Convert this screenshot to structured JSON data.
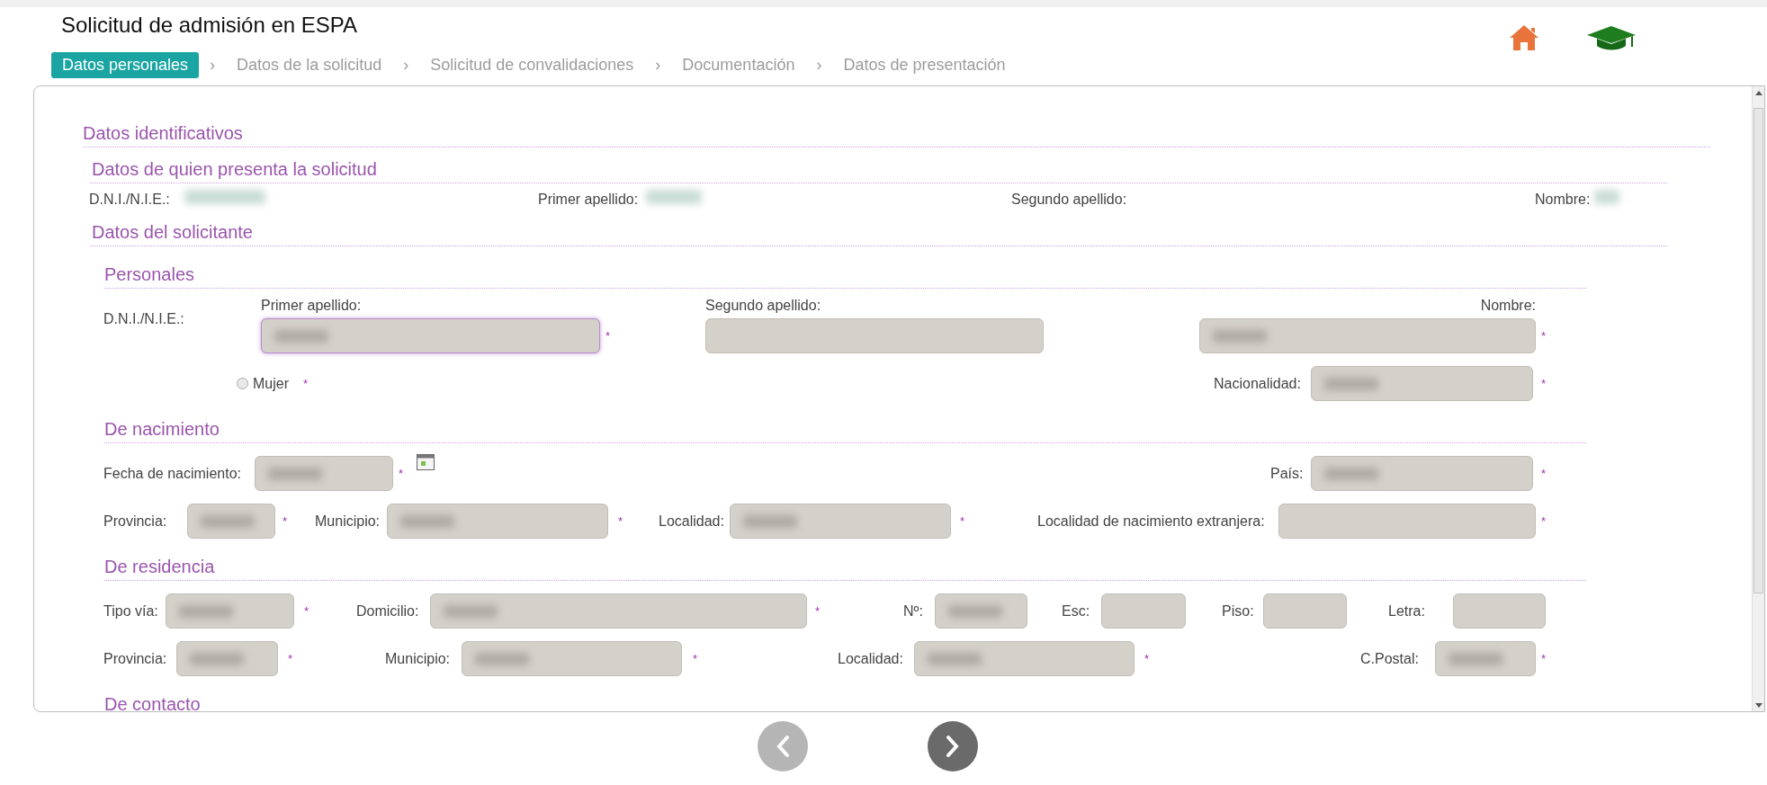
{
  "title": "Solicitud de admisión en ESPA",
  "steps": [
    {
      "label": "Datos personales",
      "selected": true
    },
    {
      "separator": "›",
      "label": "Datos de la solicitud",
      "selected": false
    },
    {
      "separator": "›",
      "label": "Solicitud de convalidaciones",
      "selected": false
    },
    {
      "separator": "›",
      "label": "Documentación",
      "selected": false
    },
    {
      "separator": "›",
      "label": "Datos de presentación",
      "selected": false
    }
  ],
  "sections": [
    {
      "title": "Datos identificativos",
      "children": [
        {
          "title": "Datos de quien presenta la solicitud",
          "rows": [
            [
              {
                "kind": "label",
                "text": "D.N.I./N.I.E.:"
              },
              {
                "kind": "value",
                "blurred": true
              },
              {
                "kind": "label",
                "text": "Primer apellido:"
              },
              {
                "kind": "value",
                "blurred": true
              },
              {
                "kind": "label",
                "text": "Segundo apellido:"
              },
              {
                "kind": "label",
                "text": "Nombre:"
              },
              {
                "kind": "value",
                "blurred": true
              }
            ]
          ]
        },
        {
          "title": "Datos del solicitante",
          "children": [
            {
              "title": "Personales",
              "rows": [
                [
                  {
                    "kind": "label",
                    "text": "D.N.I./N.I.E.:"
                  },
                  {
                    "kind": "stack",
                    "label": "Primer apellido:",
                    "blurred": true,
                    "focused": true
                  },
                  {
                    "kind": "required",
                    "text": "*"
                  },
                  {
                    "kind": "stack",
                    "label": "Segundo apellido:",
                    "blurred": false,
                    "focused": false
                  },
                  {
                    "kind": "stack",
                    "label": "Nombre:",
                    "blurred": true,
                    "focused": false
                  },
                  {
                    "kind": "required",
                    "text": "*"
                  }
                ],
                [
                  "",
                  {
                    "kind": "radio",
                    "label": "Mujer",
                    "checked": false,
                    "required": "*"
                  },
                  "",
                  {
                    "kind": "label",
                    "text": "Nacionalidad:"
                  },
                  {
                    "kind": "field",
                    "blurred": true,
                    "focused": false
                  },
                  {
                    "kind": "required",
                    "text": "*"
                  }
                ]
              ]
            },
            {
              "title": "De nacimiento",
              "rows": [
                [
                  {
                    "kind": "label",
                    "text": "Fecha de nacimiento:"
                  },
                  {
                    "kind": "field",
                    "blurred": true,
                    "focused": false
                  },
                  {
                    "kind": "required",
                    "text": "*"
                  },
                  {
                    "kind": "calendar"
                  },
                  "",
                  "",
                  "",
                  "",
                  "",
                  {
                    "kind": "label",
                    "text": "País:"
                  },
                  {
                    "kind": "field",
                    "blurred": true,
                    "focused": false
                  },
                  {
                    "kind": "required",
                    "text": "*"
                  }
                ],
                [
                  {
                    "kind": "label",
                    "text": "Provincia:"
                  },
                  {
                    "kind": "field",
                    "blurred": true,
                    "focused": false
                  },
                  {
                    "kind": "required",
                    "text": "*"
                  },
                  {
                    "kind": "label",
                    "text": "Municipio:"
                  },
                  {
                    "kind": "field",
                    "blurred": true,
                    "focused": false
                  },
                  {
                    "kind": "required",
                    "text": "*"
                  },
                  {
                    "kind": "label",
                    "text": "Localidad:"
                  },
                  {
                    "kind": "field",
                    "blurred": true,
                    "focused": false
                  },
                  {
                    "kind": "required",
                    "text": "*"
                  },
                  {
                    "kind": "label",
                    "text": "Localidad de nacimiento extranjera:"
                  },
                  {
                    "kind": "field",
                    "blurred": false,
                    "focused": false
                  },
                  {
                    "kind": "required",
                    "text": "*"
                  }
                ]
              ]
            },
            {
              "title": "De residencia",
              "rows": [
                [
                  {
                    "kind": "label",
                    "text": "Tipo vía:"
                  },
                  {
                    "kind": "field",
                    "blurred": true,
                    "focused": false
                  },
                  {
                    "kind": "required",
                    "text": "*"
                  },
                  {
                    "kind": "label",
                    "text": "Domicilio:"
                  },
                  {
                    "kind": "field",
                    "blurred": true,
                    "focused": false
                  },
                  {
                    "kind": "required",
                    "text": "*"
                  },
                  {
                    "kind": "label",
                    "text": "Nº:"
                  },
                  {
                    "kind": "field",
                    "blurred": true,
                    "focused": false
                  },
                  {
                    "kind": "label",
                    "text": "Esc:"
                  },
                  {
                    "kind": "field",
                    "blurred": false,
                    "focused": false
                  },
                  {
                    "kind": "label",
                    "text": "Piso:"
                  },
                  {
                    "kind": "field",
                    "blurred": false,
                    "focused": false
                  },
                  {
                    "kind": "label",
                    "text": "Letra:"
                  },
                  {
                    "kind": "field",
                    "blurred": false,
                    "focused": false
                  }
                ],
                [
                  {
                    "kind": "label",
                    "text": "Provincia:"
                  },
                  {
                    "kind": "field",
                    "blurred": true,
                    "focused": false
                  },
                  {
                    "kind": "required",
                    "text": "*"
                  },
                  {
                    "kind": "label",
                    "text": "Municipio:"
                  },
                  {
                    "kind": "field",
                    "blurred": true,
                    "focused": false
                  },
                  {
                    "kind": "required",
                    "text": "*"
                  },
                  {
                    "kind": "label",
                    "text": "Localidad:"
                  },
                  {
                    "kind": "field",
                    "blurred": true,
                    "focused": false
                  },
                  {
                    "kind": "required",
                    "text": "*"
                  },
                  {
                    "kind": "label",
                    "text": "C.Postal:"
                  },
                  {
                    "kind": "field",
                    "blurred": true,
                    "focused": false
                  },
                  {
                    "kind": "required",
                    "text": "*"
                  }
                ]
              ]
            },
            {
              "title": "De contacto"
            }
          ]
        }
      ]
    }
  ],
  "nav": {
    "prev": {
      "disabled": true
    },
    "next": {
      "disabled": false
    }
  }
}
